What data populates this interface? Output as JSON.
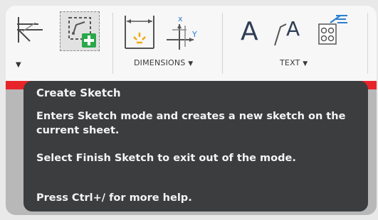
{
  "ribbon": {
    "groups": [
      {
        "label": "DIMENSIONS",
        "caret": "▼"
      },
      {
        "label": "TEXT",
        "caret": "▼"
      }
    ],
    "left_caret": "▼",
    "tools": [
      {
        "icon": "sketch-plane-icon"
      },
      {
        "icon": "create-sketch-icon"
      },
      {
        "icon": "linear-dimension-icon"
      },
      {
        "icon": "ordinate-dimension-icon"
      },
      {
        "icon": "text-icon",
        "glyph": "A"
      },
      {
        "icon": "leader-text-icon",
        "glyph": "A"
      },
      {
        "icon": "balloon-icon"
      }
    ]
  },
  "tooltip": {
    "title": "Create Sketch",
    "description": "Enters Sketch mode and creates a new sketch on the current sheet.",
    "hint": "Select Finish Sketch to exit out of the mode.",
    "help": "Press Ctrl+/ for more help."
  },
  "colors": {
    "accent_red": "#e8242b",
    "tooltip_bg": "#3b3d3f",
    "plus_green": "#2aa84a",
    "icon_blue": "#2a7fd0"
  }
}
